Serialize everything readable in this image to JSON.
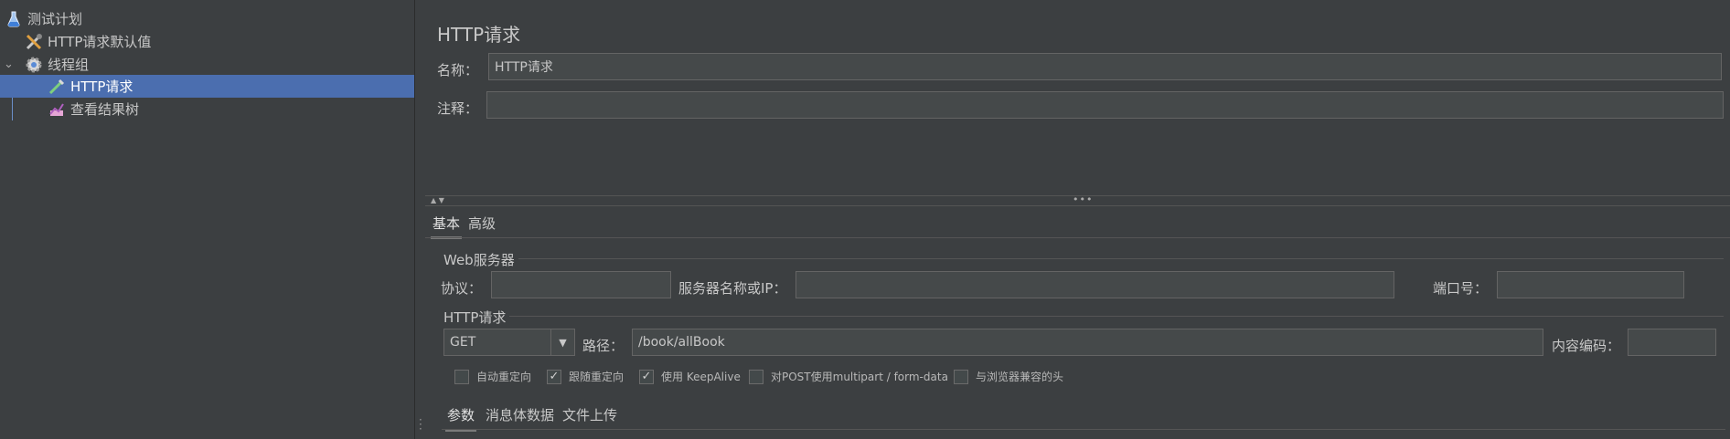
{
  "tree": {
    "items": [
      {
        "label": "测试计划",
        "icon": "flask-icon"
      },
      {
        "label": "HTTP请求默认值",
        "icon": "tools-icon"
      },
      {
        "label": "线程组",
        "icon": "gear-icon"
      },
      {
        "label": "HTTP请求",
        "icon": "pipette-icon"
      },
      {
        "label": "查看结果树",
        "icon": "chart-icon"
      }
    ]
  },
  "panel": {
    "title": "HTTP请求",
    "name_label": "名称：",
    "name_value": "HTTP请求",
    "comment_label": "注释：",
    "comment_value": ""
  },
  "tabs": {
    "basic": "基本",
    "advanced": "高级"
  },
  "web_server": {
    "group_title": "Web服务器",
    "protocol_label": "协议：",
    "protocol_value": "",
    "server_label": "服务器名称或IP：",
    "server_value": "",
    "port_label": "端口号：",
    "port_value": ""
  },
  "http_request": {
    "group_title": "HTTP请求",
    "method": "GET",
    "path_label": "路径：",
    "path_value": "/book/allBook",
    "encoding_label": "内容编码：",
    "encoding_value": ""
  },
  "options": [
    {
      "label": "自动重定向",
      "checked": false
    },
    {
      "label": "跟随重定向",
      "checked": true
    },
    {
      "label": "使用 KeepAlive",
      "checked": true
    },
    {
      "label": "对POST使用multipart / form-data",
      "checked": false
    },
    {
      "label": "与浏览器兼容的头",
      "checked": false
    }
  ],
  "subtabs": {
    "params": "参数",
    "body": "消息体数据",
    "files": "文件上传"
  }
}
